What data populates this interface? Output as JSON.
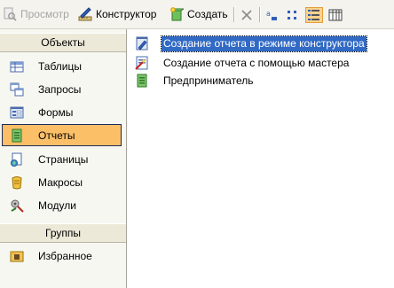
{
  "toolbar": {
    "preview_label": "Просмотр",
    "constructor_label": "Конструктор",
    "create_label": "Создать"
  },
  "sidebar": {
    "objects_header": "Объекты",
    "items": [
      {
        "label": "Таблицы",
        "icon": "table-icon"
      },
      {
        "label": "Запросы",
        "icon": "query-icon"
      },
      {
        "label": "Формы",
        "icon": "form-icon"
      },
      {
        "label": "Отчеты",
        "icon": "report-icon",
        "selected": true
      },
      {
        "label": "Страницы",
        "icon": "page-icon"
      },
      {
        "label": "Макросы",
        "icon": "macro-icon"
      },
      {
        "label": "Модули",
        "icon": "module-icon"
      }
    ],
    "groups_header": "Группы",
    "group_items": [
      {
        "label": "Избранное",
        "icon": "favorites-icon"
      }
    ]
  },
  "content": {
    "items": [
      {
        "label": "Создание отчета в режиме конструктора",
        "icon": "design-view-icon",
        "selected": true
      },
      {
        "label": "Создание отчета с помощью мастера",
        "icon": "wizard-icon"
      },
      {
        "label": "Предприниматель",
        "icon": "report-icon"
      }
    ]
  },
  "colors": {
    "selection_orange": "#fbbf68",
    "selection_blue": "#316ac5",
    "toolbar_bg": "#f4f3ee"
  }
}
